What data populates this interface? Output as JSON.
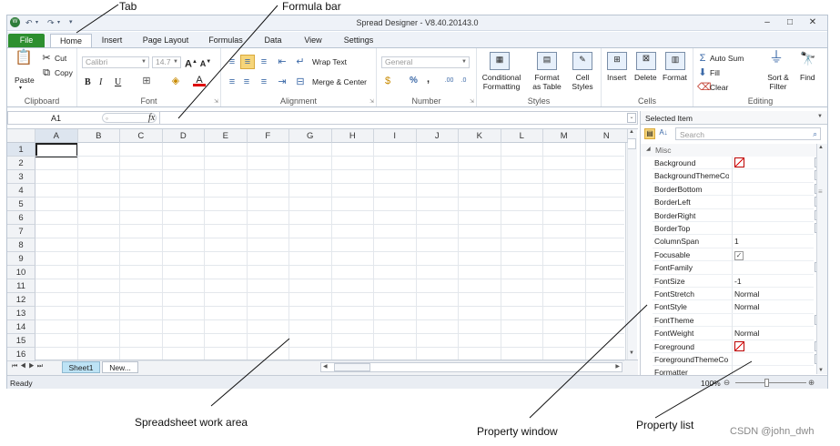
{
  "window": {
    "title": "Spread Designer - V8.40.20143.0",
    "controls": [
      "–",
      "□",
      "✕"
    ]
  },
  "quick_access": {
    "app_icon": "spread-logo-icon",
    "undo": "↶",
    "redo": "↷"
  },
  "tabs": [
    {
      "label": "File"
    },
    {
      "label": "Home"
    },
    {
      "label": "Insert"
    },
    {
      "label": "Page Layout"
    },
    {
      "label": "Formulas"
    },
    {
      "label": "Data"
    },
    {
      "label": "View"
    },
    {
      "label": "Settings"
    }
  ],
  "ribbon": {
    "clipboard": {
      "label": "Clipboard",
      "paste": "Paste",
      "cut": "Cut",
      "copy": "Copy"
    },
    "font": {
      "label": "Font",
      "family": "Calibri",
      "size": "14.7",
      "bold": "B",
      "italic": "I",
      "underline": "U"
    },
    "alignment": {
      "label": "Alignment",
      "wrap": "Wrap Text",
      "merge": "Merge & Center"
    },
    "number": {
      "label": "Number",
      "format": "General",
      "percent": "%",
      "comma": ","
    },
    "styles": {
      "label": "Styles",
      "conditional": [
        "Conditional",
        "Formatting"
      ],
      "table": [
        "Format",
        "as Table"
      ],
      "cell": [
        "Cell",
        "Styles"
      ]
    },
    "cells": {
      "label": "Cells",
      "insert": "Insert",
      "delete": "Delete",
      "format": "Format"
    },
    "editing": {
      "label": "Editing",
      "autosum": "Auto Sum",
      "fill": "Fill",
      "clear": "Clear",
      "sort": [
        "Sort &",
        "Filter"
      ],
      "find": "Find"
    }
  },
  "formula_bar": {
    "cell_ref": "A1",
    "fx": "fx",
    "value": ""
  },
  "grid": {
    "columns": [
      "A",
      "B",
      "C",
      "D",
      "E",
      "F",
      "G",
      "H",
      "I",
      "J",
      "K",
      "L",
      "M",
      "N"
    ],
    "rows": [
      "1",
      "2",
      "3",
      "4",
      "5",
      "6",
      "7",
      "8",
      "9",
      "10",
      "11",
      "12",
      "13",
      "14",
      "15",
      "16"
    ],
    "active_cell": "A1"
  },
  "sheet_tabs": [
    "Sheet1",
    "New..."
  ],
  "status": {
    "text": "Ready",
    "zoom": "100%"
  },
  "property_window": {
    "header": "Selected Item",
    "search_placeholder": "Search",
    "category": "Misc",
    "properties": [
      {
        "name": "Background",
        "value": "",
        "type": "color",
        "dropdown": true
      },
      {
        "name": "BackgroundThemeCo",
        "value": "",
        "type": "text",
        "dropdown": true
      },
      {
        "name": "BorderBottom",
        "value": "",
        "type": "text",
        "dropdown": true
      },
      {
        "name": "BorderLeft",
        "value": "",
        "type": "text",
        "dropdown": true
      },
      {
        "name": "BorderRight",
        "value": "",
        "type": "text",
        "dropdown": true
      },
      {
        "name": "BorderTop",
        "value": "",
        "type": "text",
        "dropdown": true
      },
      {
        "name": "ColumnSpan",
        "value": "1",
        "type": "text",
        "dropdown": false
      },
      {
        "name": "Focusable",
        "value": "✓",
        "type": "check",
        "dropdown": false
      },
      {
        "name": "FontFamily",
        "value": "",
        "type": "text",
        "dropdown": true
      },
      {
        "name": "FontSize",
        "value": "-1",
        "type": "text",
        "dropdown": false
      },
      {
        "name": "FontStretch",
        "value": "Normal",
        "type": "text",
        "dropdown": false
      },
      {
        "name": "FontStyle",
        "value": "Normal",
        "type": "text",
        "dropdown": false
      },
      {
        "name": "FontTheme",
        "value": "",
        "type": "text",
        "dropdown": true
      },
      {
        "name": "FontWeight",
        "value": "Normal",
        "type": "text",
        "dropdown": false
      },
      {
        "name": "Foreground",
        "value": "",
        "type": "color",
        "dropdown": true
      },
      {
        "name": "ForegroundThemeCo",
        "value": "",
        "type": "text",
        "dropdown": true
      },
      {
        "name": "Formatter",
        "value": "",
        "type": "text",
        "dropdown": false
      }
    ]
  },
  "annotations": {
    "tab": "Tab",
    "formula_bar": "Formula bar",
    "work_area": "Spreadsheet work area",
    "property_window": "Property window",
    "property_list": "Property list",
    "watermark": "CSDN @john_dwh"
  }
}
